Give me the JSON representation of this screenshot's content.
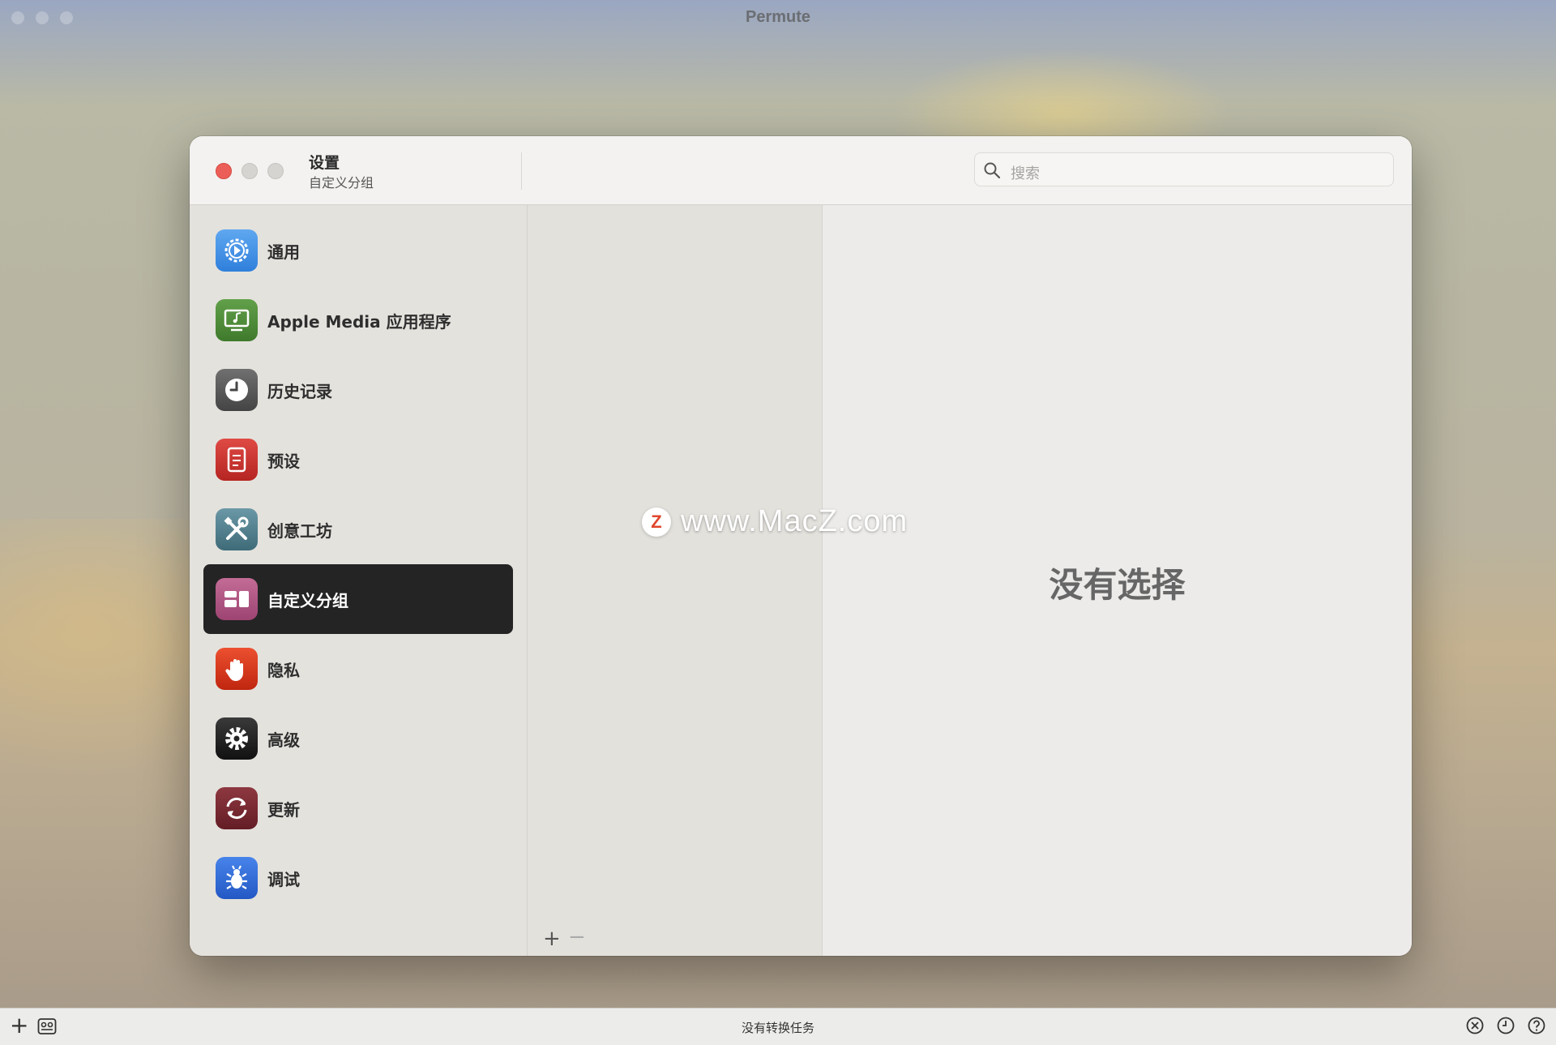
{
  "app": {
    "title": "Permute"
  },
  "settings_window": {
    "title": "设置",
    "subtitle": "自定义分组",
    "search": {
      "placeholder": "搜索"
    }
  },
  "sidebar": {
    "items": [
      {
        "label": "通用",
        "icon": "gear-badge-icon",
        "color": "#3d8ee8",
        "selected": false
      },
      {
        "label": "Apple Media 应用程序",
        "icon": "monitor-music-icon",
        "color": "#4f8a3a",
        "selected": false
      },
      {
        "label": "历史记录",
        "icon": "clock-icon",
        "color": "#5a5a5a",
        "selected": false
      },
      {
        "label": "预设",
        "icon": "preset-document-icon",
        "color": "#c8322f",
        "selected": false
      },
      {
        "label": "创意工坊",
        "icon": "tools-icon",
        "color": "#4f7f8e",
        "selected": false
      },
      {
        "label": "自定义分组",
        "icon": "custom-groups-icon",
        "color": "#b0507e",
        "selected": true
      },
      {
        "label": "隐私",
        "icon": "hand-icon",
        "color": "#d4381f",
        "selected": false
      },
      {
        "label": "高级",
        "icon": "gear-icon",
        "color": "#222222",
        "selected": false
      },
      {
        "label": "更新",
        "icon": "refresh-icon",
        "color": "#7a2b33",
        "selected": false
      },
      {
        "label": "调试",
        "icon": "bug-icon",
        "color": "#2f6fd8",
        "selected": false
      }
    ]
  },
  "middle": {
    "add_label": "+",
    "remove_label": "−"
  },
  "detail": {
    "empty_text": "没有选择"
  },
  "watermark": {
    "logo": "Z",
    "text": "www.MacZ.com"
  },
  "bottombar": {
    "add_label": "+",
    "status": "没有转换任务"
  }
}
